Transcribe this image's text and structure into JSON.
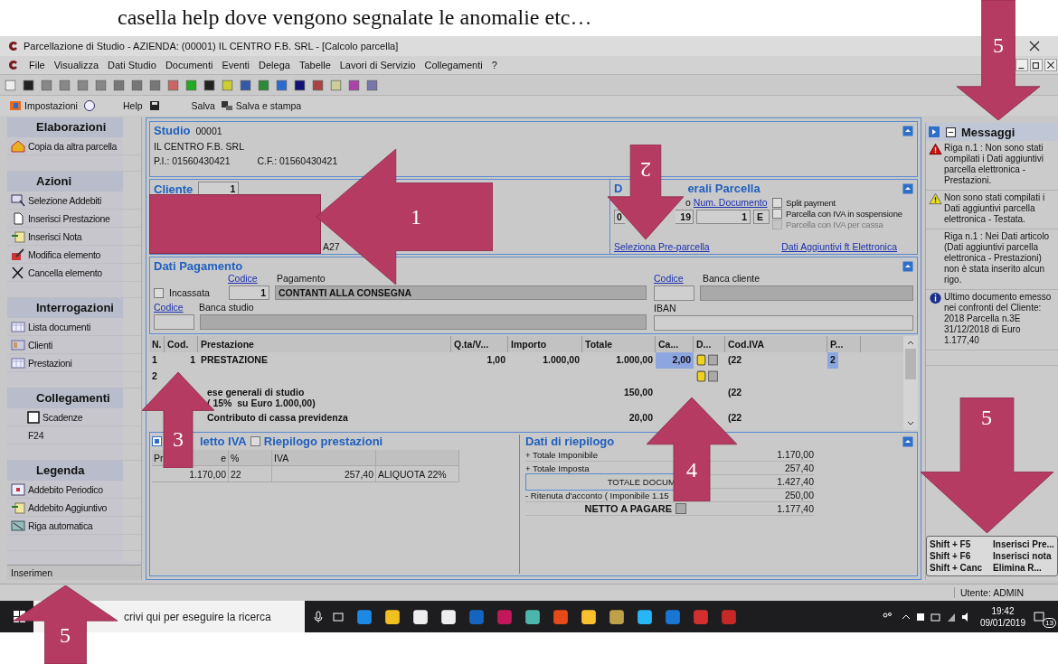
{
  "doc_caption": "casella help dove vengono segnalate le anomalie etc…",
  "window": {
    "title": "Parcellazione di Studio - AZIENDA:  (00001) IL CENTRO F.B. SRL  - [Calcolo parcella]"
  },
  "menu": [
    "File",
    "Visualizza",
    "Dati Studio",
    "Documenti",
    "Eventi",
    "Delega",
    "Tabelle",
    "Lavori di Servizio",
    "Collegamenti",
    "?"
  ],
  "toolbar2": {
    "settings": "Impostazioni",
    "help": "Help",
    "save": "Salva",
    "save_print": "Salva e stampa"
  },
  "sidebar": {
    "sections": [
      {
        "title": "Elaborazioni",
        "items": [
          {
            "label": "Copia da altra parcella",
            "kind": "house"
          }
        ]
      },
      {
        "title": "Azioni",
        "items": [
          {
            "label": "Selezione Addebiti",
            "kind": "select"
          },
          {
            "label": "Inserisci Prestazione",
            "kind": "page"
          },
          {
            "label": "Inserisci Nota",
            "kind": "note"
          },
          {
            "label": "Modifica elemento",
            "kind": "edit"
          },
          {
            "label": "Cancella elemento",
            "kind": "cross"
          }
        ]
      },
      {
        "title": "Interrogazioni",
        "items": [
          {
            "label": "Lista documenti",
            "kind": "table"
          },
          {
            "label": "Clienti",
            "kind": "card"
          },
          {
            "label": "Prestazioni",
            "kind": "table"
          }
        ]
      },
      {
        "title": "Collegamenti",
        "items": [
          {
            "label": "Scadenze",
            "kind": "checkbox",
            "checked": false
          },
          {
            "label": "F24",
            "kind": "plain"
          }
        ]
      },
      {
        "title": "Legenda",
        "items": [
          {
            "label": "Addebito Periodico",
            "kind": "calendar"
          },
          {
            "label": "Addebito Aggiuntivo",
            "kind": "note"
          },
          {
            "label": "Riga automatica",
            "kind": "auto"
          }
        ]
      }
    ],
    "status": "Inserimen"
  },
  "studio": {
    "label": "Studio",
    "code": "00001",
    "name": "IL CENTRO F.B. SRL",
    "piva": "P.I.: 01560430421",
    "cf": "C.F.: 01560430421"
  },
  "cliente": {
    "label": "Cliente",
    "code": "1",
    "fragment": "A27"
  },
  "dati_generali": {
    "title_start": "D",
    "title_end": "erali Parcella",
    "label_fragment": "o",
    "num_doc_label": "Num. Documento",
    "date_start": "0",
    "date_end": "19",
    "num_doc": "1",
    "suffix": "E",
    "options": [
      {
        "label": "Split payment",
        "checked": false,
        "disabled": false
      },
      {
        "label": "Parcella con IVA in sospensione",
        "checked": false,
        "disabled": false
      },
      {
        "label": "Parcella con IVA per cassa",
        "checked": false,
        "disabled": true
      }
    ],
    "link_pre": "Seleziona Pre-parcella",
    "link_ft": "Dati Aggiuntivi ft Elettronica"
  },
  "pagamento": {
    "title": "Dati Pagamento",
    "codice_label": "Codice",
    "pagamento_label": "Pagamento",
    "incassata": {
      "label": "Incassata",
      "checked": false
    },
    "pay_code": "1",
    "pay_desc": "CONTANTI ALLA CONSEGNA",
    "codice_studio": "Codice",
    "banca_studio": "Banca studio",
    "codice_cliente": "Codice",
    "banca_cliente": "Banca cliente",
    "iban": "IBAN"
  },
  "grid": {
    "columns": [
      "N.",
      "Cod.",
      "Prestazione",
      "Q.ta/V...",
      "Importo",
      "Totale",
      "Ca...",
      "D...",
      "Cod.IVA",
      "P..."
    ],
    "rows": [
      {
        "n": "1",
        "cod": "1",
        "desc": "PRESTAZIONE",
        "qty": "1,00",
        "importo": "1.000,00",
        "totale": "1.000,00",
        "ca": "2,00",
        "doc_icons": true,
        "iva": "(22",
        "p": "2"
      },
      {
        "n": "2",
        "doc_icons": true
      },
      {
        "desc": "ese generali di studio",
        "desc2": "( 15%  su Euro 1.000,00)",
        "totale": "150,00",
        "iva": "(22"
      },
      {
        "desc": "Contributo di cassa previdenza",
        "totale": "20,00",
        "iva": "(22"
      }
    ]
  },
  "iva": {
    "tab1": {
      "label": "letto IVA",
      "checked": true
    },
    "tab2": {
      "label": "Riepilogo prestazioni",
      "checked": false
    },
    "columns": [
      "Pr",
      "e",
      "%",
      "IVA"
    ],
    "row": [
      "1.170,00",
      "22",
      "257,40",
      "ALIQUOTA 22%"
    ]
  },
  "riepilogo": {
    "title": "Dati di riepilogo",
    "rows": [
      {
        "label": "+ Totale Imponibile",
        "value": "1.170,00",
        "kind": "plain"
      },
      {
        "label": "+ Totale Imposta",
        "value": "257,40",
        "kind": "plain"
      },
      {
        "label": "TOTALE DOCUM",
        "value": "1.427,40",
        "kind": "center"
      },
      {
        "label": "- Ritenuta d'acconto  ( Imponibile 1.15",
        "value": "250,00",
        "kind": "plain"
      },
      {
        "label": "NETTO A PAGARE",
        "value": "1.177,40",
        "kind": "bold"
      }
    ]
  },
  "messages": {
    "title": "Messaggi",
    "items": [
      {
        "kind": "error",
        "text": "Riga n.1 : Non sono stati compilati i Dati aggiuntivi parcella elettronica - Prestazioni."
      },
      {
        "kind": "warning",
        "text": "Non sono stati compilati i Dati aggiuntivi parcella elettronica - Testata."
      },
      {
        "kind": "none",
        "text": "Riga n.1 : Nei Dati articolo (Dati aggiuntivi parcella elettronica - Prestazioni) non è stata inserito alcun rigo."
      },
      {
        "kind": "info",
        "text": "Ultimo documento emesso nei confronti del Cliente: 2018 Parcella n.3E 31/12/2018 di Euro 1.177,40"
      }
    ]
  },
  "shortcuts": [
    {
      "keys": "Shift + F5",
      "action": "Inserisci Pre..."
    },
    {
      "keys": "Shift + F6",
      "action": "Inserisci nota"
    },
    {
      "keys": "Shift + Canc",
      "action": "Elimina R..."
    }
  ],
  "status_bar": {
    "user": "Utente: ADMIN"
  },
  "taskbar": {
    "search": "crivi qui per eseguire la ricerca",
    "time": "19:42",
    "date": "09/01/2019",
    "notifications": "13"
  },
  "annotations": [
    {
      "number": "1",
      "kind": "left"
    },
    {
      "number": "2",
      "kind": "down"
    },
    {
      "number": "3",
      "kind": "up"
    },
    {
      "number": "4",
      "kind": "up"
    },
    {
      "number": "5",
      "kind": "down"
    },
    {
      "number": "5",
      "kind": "down"
    },
    {
      "number": "5",
      "kind": "up"
    }
  ]
}
